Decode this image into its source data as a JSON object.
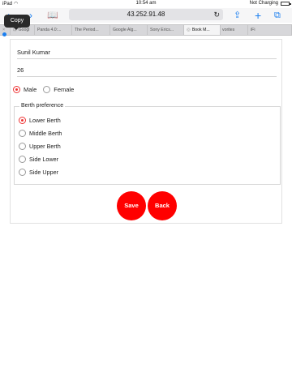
{
  "status_bar": {
    "device": "iPad",
    "time": "10:54 am",
    "charging": "Not Charging"
  },
  "toolbar": {
    "url": "43.252.91.48",
    "icons": [
      "back-icon",
      "forward-icon",
      "bookmarks-icon",
      "reload-icon",
      "share-icon",
      "new-tab-icon",
      "tabs-icon"
    ]
  },
  "tooltip": {
    "label": "Copy"
  },
  "tabs": [
    {
      "label": "Googl",
      "active": false
    },
    {
      "label": "Panda 4.0:...",
      "active": false
    },
    {
      "label": "The Period...",
      "active": false
    },
    {
      "label": "Google Alg...",
      "active": false
    },
    {
      "label": "Sony Erics...",
      "active": false
    },
    {
      "label": "Book M...",
      "active": true
    },
    {
      "label": "vorites",
      "active": false
    },
    {
      "label": "iFi",
      "active": false
    }
  ],
  "form": {
    "name_value": "Sunil Kumar",
    "age_value": "26",
    "gender": {
      "options": [
        "Male",
        "Female"
      ],
      "selected": "Male"
    },
    "berth": {
      "legend": "Berth preference",
      "options": [
        "Lower Berth",
        "Middle Berth",
        "Upper Berth",
        "Side Lower",
        "Side Upper"
      ],
      "selected": "Lower Berth"
    },
    "save_label": "Save",
    "back_label": "Back"
  },
  "colors": {
    "accent": "#ff0000",
    "ios_blue": "#1b7ff0"
  }
}
